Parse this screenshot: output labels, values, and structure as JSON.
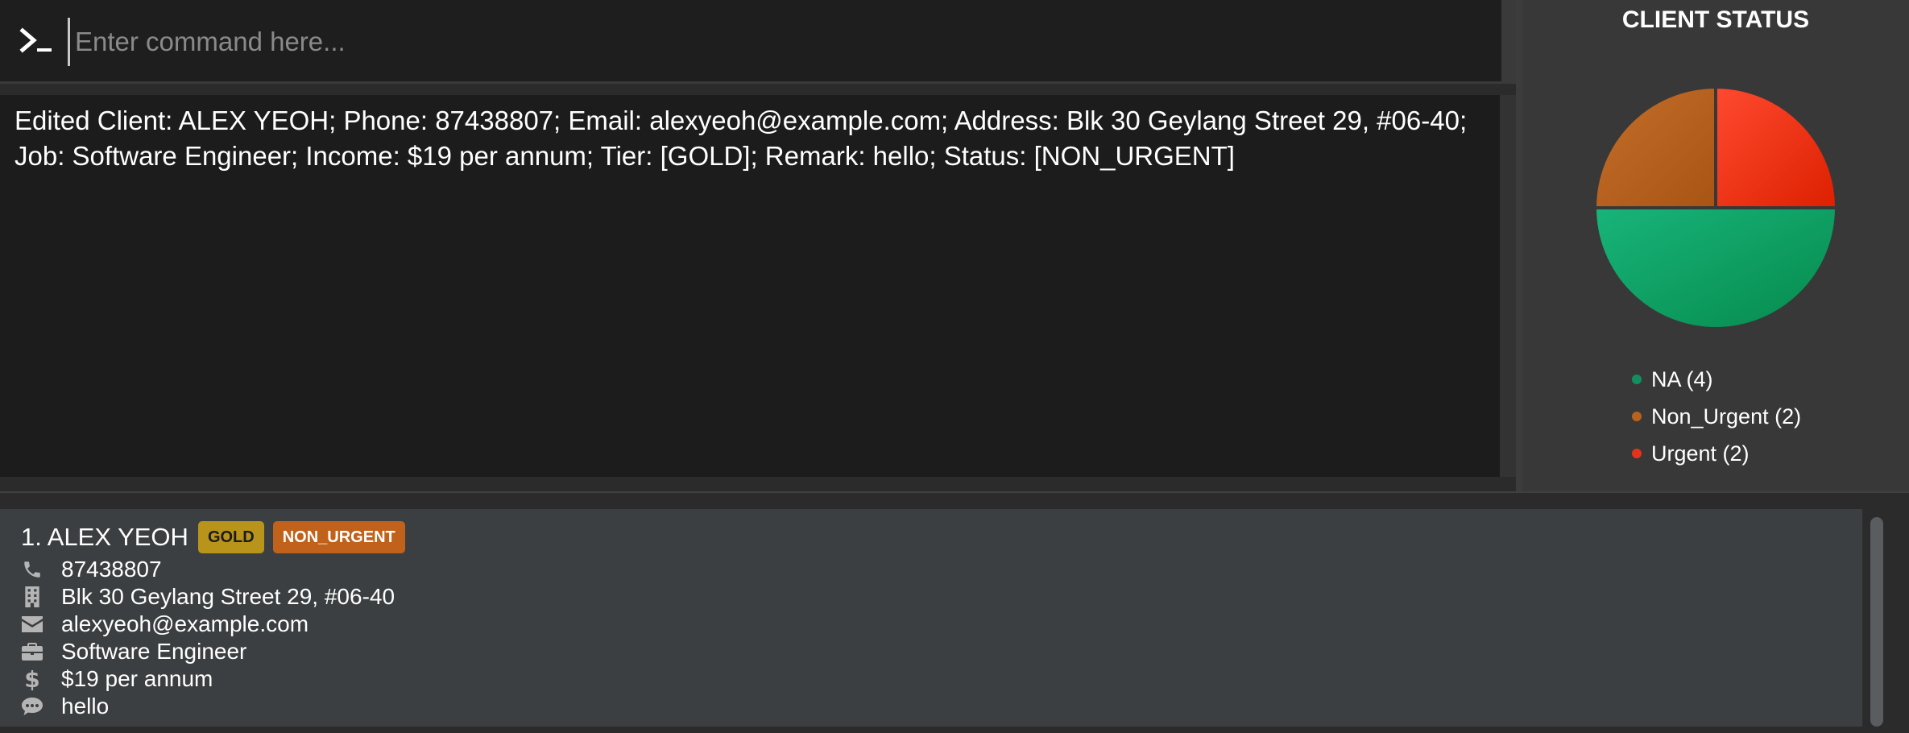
{
  "command": {
    "placeholder": "Enter command here..."
  },
  "result": {
    "text": "Edited Client: ALEX YEOH; Phone: 87438807; Email: alexyeoh@example.com; Address: Blk 30 Geylang Street 29, #06-40; Job: Software Engineer; Income: $19 per annum; Tier: [GOLD]; Remark: hello; Status: [NON_URGENT]"
  },
  "status_panel": {
    "title": "CLIENT STATUS"
  },
  "chart_data": {
    "type": "pie",
    "title": "CLIENT STATUS",
    "slices": [
      {
        "label": "NA (4)",
        "name": "NA",
        "value": 4,
        "color": "#109060"
      },
      {
        "label": "Non_Urgent (2)",
        "name": "Non_Urgent",
        "value": 2,
        "color": "#b8621e"
      },
      {
        "label": "Urgent (2)",
        "name": "Urgent",
        "value": 2,
        "color": "#e5331a"
      }
    ],
    "legend_position": "bottom"
  },
  "clients": [
    {
      "index_name": "1. ALEX YEOH",
      "tier": "GOLD",
      "status": "NON_URGENT",
      "phone": "87438807",
      "address": "Blk 30 Geylang Street 29, #06-40",
      "email": "alexyeoh@example.com",
      "job": "Software Engineer",
      "income": "$19 per annum",
      "remark": "hello"
    }
  ],
  "colors": {
    "tier_gold": "#b8941a",
    "status_non_urgent": "#c0621b",
    "background": "#2b2b2b",
    "card": "#3c3f41"
  }
}
